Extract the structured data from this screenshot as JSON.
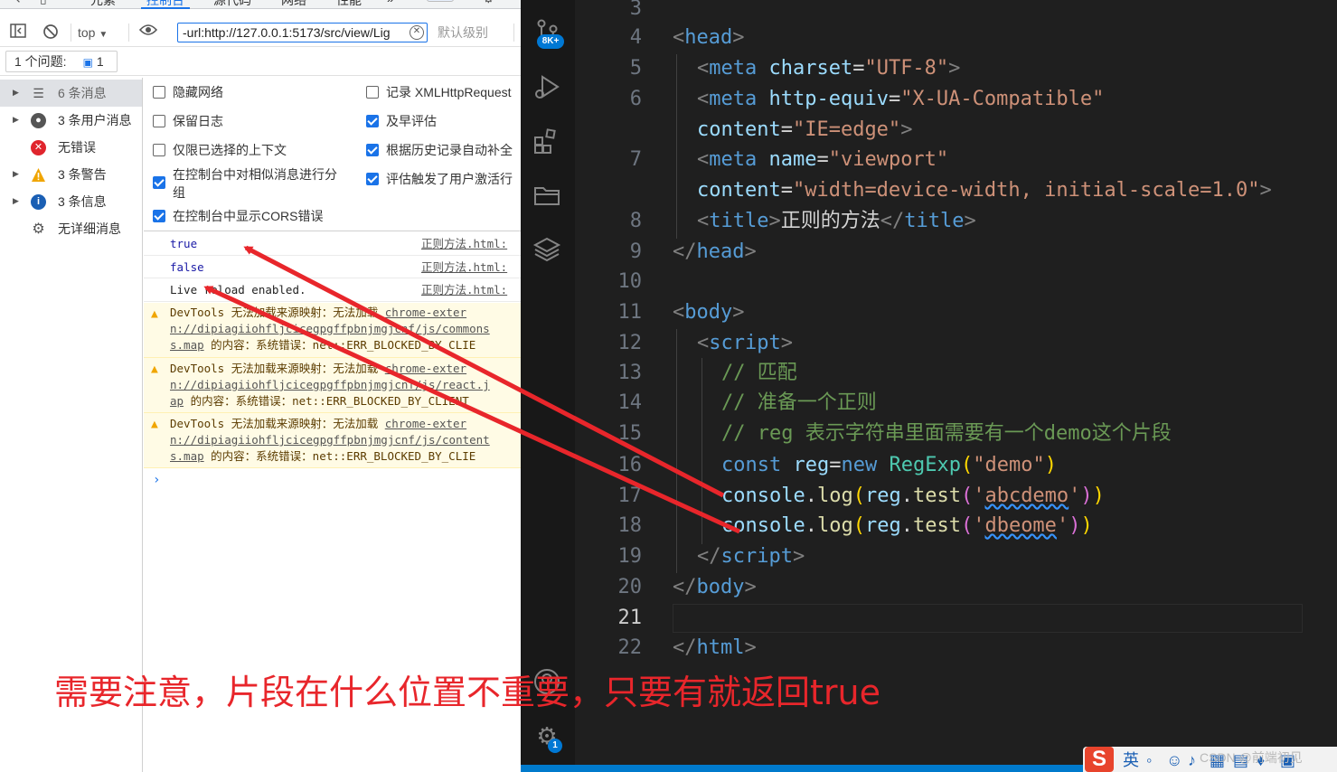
{
  "devtools": {
    "tabs": [
      "元素",
      "控制台",
      "源代码",
      "网络",
      "性能"
    ],
    "active_tab": "控制台",
    "more_tabs_glyph": "»",
    "issue_badge_count": "1",
    "toolbar": {
      "context_label": "top",
      "filter_value": "-url:http://127.0.0.1:5173/src/view/Lig",
      "level_label": "默认级别"
    },
    "issues_bar": {
      "label": "1 个问题:",
      "count": "1"
    },
    "sidebar": {
      "items": [
        {
          "label": "6 条消息",
          "icon": "list-icon"
        },
        {
          "label": "3 条用户消息",
          "icon": "user-icon"
        },
        {
          "label": "无错误",
          "icon": "error-icon"
        },
        {
          "label": "3 条警告",
          "icon": "warning-icon"
        },
        {
          "label": "3 条信息",
          "icon": "info-icon"
        },
        {
          "label": "无详细消息",
          "icon": "gear-icon"
        }
      ]
    },
    "settings": {
      "left": [
        {
          "label": "隐藏网络",
          "checked": false
        },
        {
          "label": "保留日志",
          "checked": false
        },
        {
          "label": "仅限已选择的上下文",
          "checked": false
        },
        {
          "label_line1": "在控制台中对相似消息进行分",
          "label_line2": "组",
          "checked": true
        },
        {
          "label": "在控制台中显示CORS错误",
          "checked": true
        }
      ],
      "right": [
        {
          "label": "记录 XMLHttpRequest",
          "checked": false
        },
        {
          "label": "及早评估",
          "checked": true
        },
        {
          "label": "根据历史记录自动补全",
          "checked": true
        },
        {
          "label": "评估触发了用户激活行",
          "checked": true
        }
      ]
    },
    "log": [
      {
        "text": "true",
        "source": "正则方法.html:"
      },
      {
        "text": "false",
        "source": "正则方法.html:"
      },
      {
        "text": "Live reload enabled.",
        "source": "正则方法.html:"
      }
    ],
    "warnings": [
      {
        "prefix": "DevTools 无法加载来源映射：无法加载",
        "link1": "chrome-exter",
        "link2": "n://dipiagiiohfljcicegpgffpbnjmgjcnf/js/commons",
        "link3": "s.map",
        "suffix": "的内容：系统错误：net::ERR_BLOCKED_BY_CLIE"
      },
      {
        "prefix": "DevTools 无法加载来源映射：无法加载",
        "link1": "chrome-exter",
        "link2": "n://dipiagiiohfljcicegpgffpbnjmgjcnf/js/react.j",
        "link3": "ap",
        "suffix": "的内容：系统错误：net::ERR_BLOCKED_BY_CLIENT"
      },
      {
        "prefix": "DevTools 无法加载来源映射：无法加载",
        "link1": "chrome-exter",
        "link2": "n://dipiagiiohfljcicegpgffpbnjmgjcnf/js/content",
        "link3": "s.map",
        "suffix": "的内容：系统错误：net::ERR_BLOCKED_BY_CLIE"
      }
    ],
    "prompt_glyph": "›"
  },
  "vscode": {
    "activity_badges": {
      "explorer": "8K+",
      "settings": "1"
    },
    "line_numbers": [
      "3",
      "4",
      "5",
      "6",
      "",
      "7",
      "",
      "8",
      "9",
      "10",
      "11",
      "12",
      "13",
      "14",
      "15",
      "16",
      "17",
      "18",
      "19",
      "20",
      "21",
      "22"
    ],
    "active_line": "21",
    "code": {
      "l4_tag": "head",
      "l5_tag": "meta",
      "l5_attr": "charset",
      "l5_val": "\"UTF-8\"",
      "l6_tag": "meta",
      "l6_attr": "http-equiv",
      "l6_val": "\"X-UA-Compatible\"",
      "l6b_attr": "content",
      "l6b_val": "\"IE=edge\"",
      "l7_tag": "meta",
      "l7_attr": "name",
      "l7_val": "\"viewport\"",
      "l7b_attr": "content",
      "l7b_val": "\"width=device-width, initial-scale=1.0\"",
      "l8_tag": "title",
      "l8_text": "正则的方法",
      "l11_tag": "body",
      "l12_tag": "script",
      "l13_comment": "// 匹配",
      "l14_comment": "// 准备一个正则",
      "l15_comment": "// reg 表示字符串里面需要有一个demo这个片段",
      "l16_kw": "const",
      "l16_var": "reg",
      "l16_new": "new",
      "l16_cls": "RegExp",
      "l16_str": "\"demo\"",
      "l17_obj": "console",
      "l17_fn": "log",
      "l17_var": "reg",
      "l17_fn2": "test",
      "l17_q": "'",
      "l17_str": "abcdemo",
      "l18_obj": "console",
      "l18_fn": "log",
      "l18_var": "reg",
      "l18_fn2": "test",
      "l18_q": "'",
      "l18_str": "dbeome",
      "l20_tag": "body",
      "l22_tag": "html"
    }
  },
  "ime": {
    "logo": "S",
    "lang": "英"
  },
  "watermark": "CSDN @前端初见",
  "annotation": {
    "caption": "需要注意，片段在什么位置不重要，只要有就返回true",
    "arrow_color": "#e8262b"
  }
}
